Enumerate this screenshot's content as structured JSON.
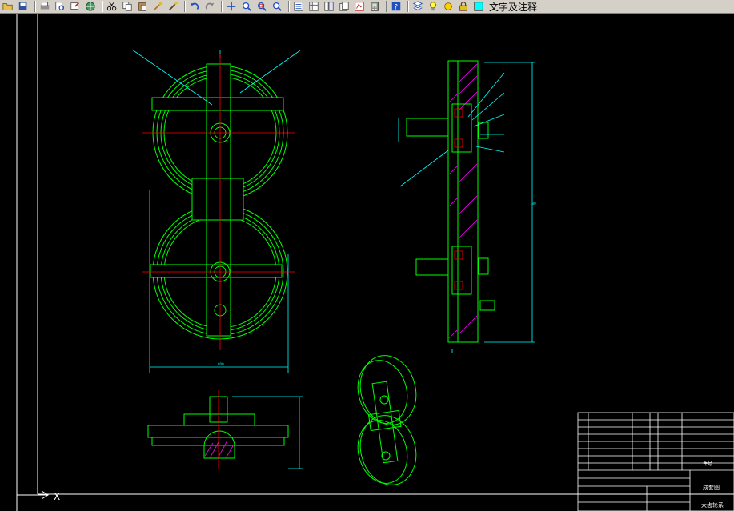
{
  "toolbar": {
    "buttons": [
      {
        "name": "open-icon",
        "group": 1
      },
      {
        "name": "save-icon",
        "group": 1
      },
      {
        "name": "print-icon",
        "group": 2
      },
      {
        "name": "print-preview-icon",
        "group": 2
      },
      {
        "name": "publish-icon",
        "group": 2
      },
      {
        "name": "globe-icon",
        "group": 2
      },
      {
        "name": "cut-icon",
        "group": 3
      },
      {
        "name": "copy-icon",
        "group": 3
      },
      {
        "name": "paste-icon",
        "group": 3
      },
      {
        "name": "match-properties-icon",
        "group": 3
      },
      {
        "name": "brush-icon",
        "group": 3
      },
      {
        "name": "undo-icon",
        "group": 4
      },
      {
        "name": "redo-icon",
        "group": 4
      },
      {
        "name": "pan-icon",
        "group": 5
      },
      {
        "name": "zoom-realtime-icon",
        "group": 5
      },
      {
        "name": "zoom-window-icon",
        "group": 5
      },
      {
        "name": "zoom-previous-icon",
        "group": 5
      },
      {
        "name": "properties-icon",
        "group": 6
      },
      {
        "name": "design-center-icon",
        "group": 6
      },
      {
        "name": "tool-palettes-icon",
        "group": 6
      },
      {
        "name": "sheet-set-icon",
        "group": 6
      },
      {
        "name": "markup-icon",
        "group": 6
      },
      {
        "name": "calculator-icon",
        "group": 6
      },
      {
        "name": "help-icon",
        "group": 7
      },
      {
        "name": "layers-icon",
        "group": 8
      }
    ],
    "layer_icons": [
      "bulb-on-icon",
      "sun-icon",
      "lock-icon",
      "color-swatch-icon"
    ],
    "layer_name": "文字及注释"
  },
  "ucs": {
    "label": "X"
  },
  "colors": {
    "toolbar_bg": "#d4d0c8",
    "model_bg": "#000000",
    "outline": "#00ff00",
    "dimension": "#00ffff",
    "center": "#ff0000",
    "hatch": "#ff00ff",
    "text": "#ffffff",
    "frame": "#ffffff"
  },
  "drawing": {
    "title_block": {
      "drawing_title": "成套图",
      "part_title": "大齿轮系"
    }
  }
}
